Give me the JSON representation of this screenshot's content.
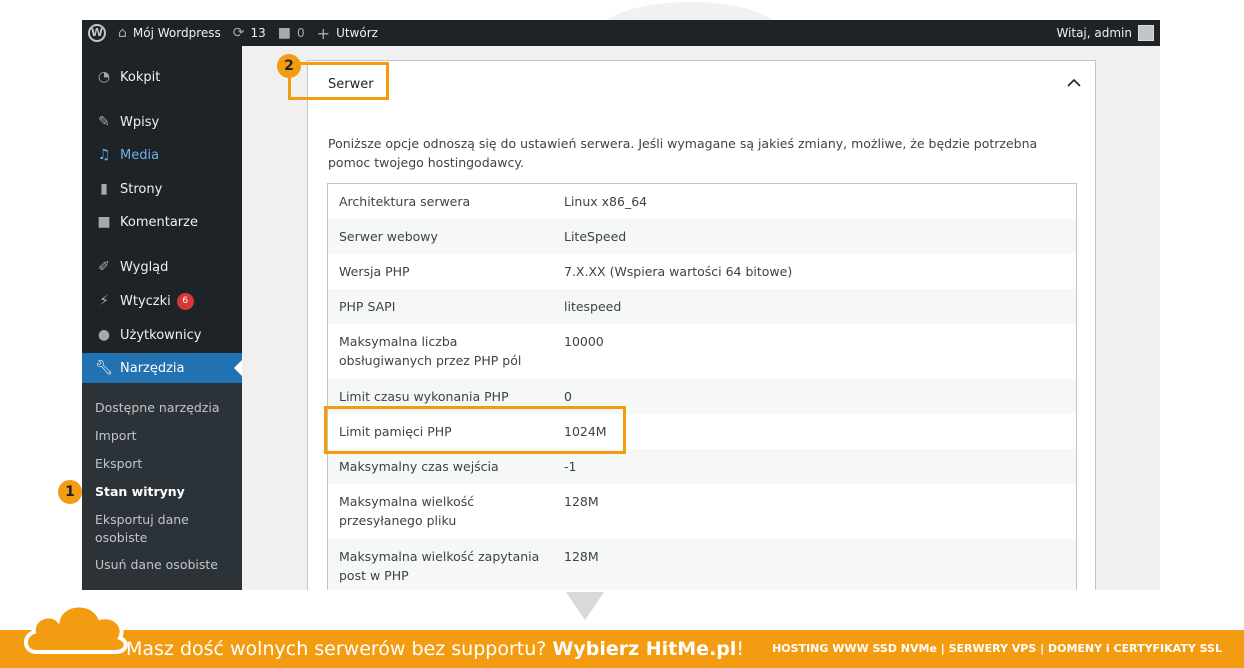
{
  "adminbar": {
    "site_name": "Mój Wordpress",
    "updates_count": "13",
    "comments_count": "0",
    "new_label": "Utwórz",
    "greeting": "Witaj, admin"
  },
  "sidebar": {
    "items": [
      {
        "label": "Kokpit",
        "icon": "dashboard-icon"
      },
      {
        "label": "Wpisy",
        "icon": "pin-icon"
      },
      {
        "label": "Media",
        "icon": "media-icon"
      },
      {
        "label": "Strony",
        "icon": "pages-icon"
      },
      {
        "label": "Komentarze",
        "icon": "comment-icon"
      },
      {
        "label": "Wygląd",
        "icon": "brush-icon"
      },
      {
        "label": "Wtyczki",
        "icon": "plugin-icon",
        "badge": "6"
      },
      {
        "label": "Użytkownicy",
        "icon": "users-icon"
      },
      {
        "label": "Narzędzia",
        "icon": "wrench-icon"
      }
    ],
    "submenu": [
      "Dostępne narzędzia",
      "Import",
      "Eksport",
      "Stan witryny",
      "Eksportuj dane osobiste",
      "Usuń dane osobiste"
    ]
  },
  "panel": {
    "title": "Serwer",
    "description": "Poniższe opcje odnoszą się do ustawień serwera. Jeśli wymagane są jakieś zmiany, możliwe, że będzie potrzebna pomoc twojego hostingodawcy.",
    "rows": [
      {
        "label": "Architektura serwera",
        "value": "Linux x86_64"
      },
      {
        "label": "Serwer webowy",
        "value": "LiteSpeed"
      },
      {
        "label": "Wersja PHP",
        "value": "7.X.XX (Wspiera wartości 64 bitowe)"
      },
      {
        "label": "PHP SAPI",
        "value": "litespeed"
      },
      {
        "label": "Maksymalna liczba obsługiwanych przez PHP pól",
        "value": "10000"
      },
      {
        "label": "Limit czasu wykonania PHP",
        "value": "0"
      },
      {
        "label": "Limit pamięci PHP",
        "value": "1024M"
      },
      {
        "label": "Maksymalny czas wejścia",
        "value": "-1"
      },
      {
        "label": "Maksymalna wielkość przesyłanego pliku",
        "value": "128M"
      },
      {
        "label": "Maksymalna wielkość zapytania post w PHP",
        "value": "128M"
      }
    ]
  },
  "markers": {
    "step1": "1",
    "step2": "2"
  },
  "banner": {
    "slogan_plain": "Masz dość wolnych serwerów bez supportu? ",
    "slogan_bold": "Wybierz HitMe.pl",
    "slogan_end": "!",
    "tagline": "HOSTING WWW SSD NVMe | SERWERY VPS | DOMENY i CERTYFIKATY SSL"
  },
  "colors": {
    "accent": "#f39c12",
    "admin_dark": "#1d2327",
    "active_blue": "#2271b1"
  }
}
